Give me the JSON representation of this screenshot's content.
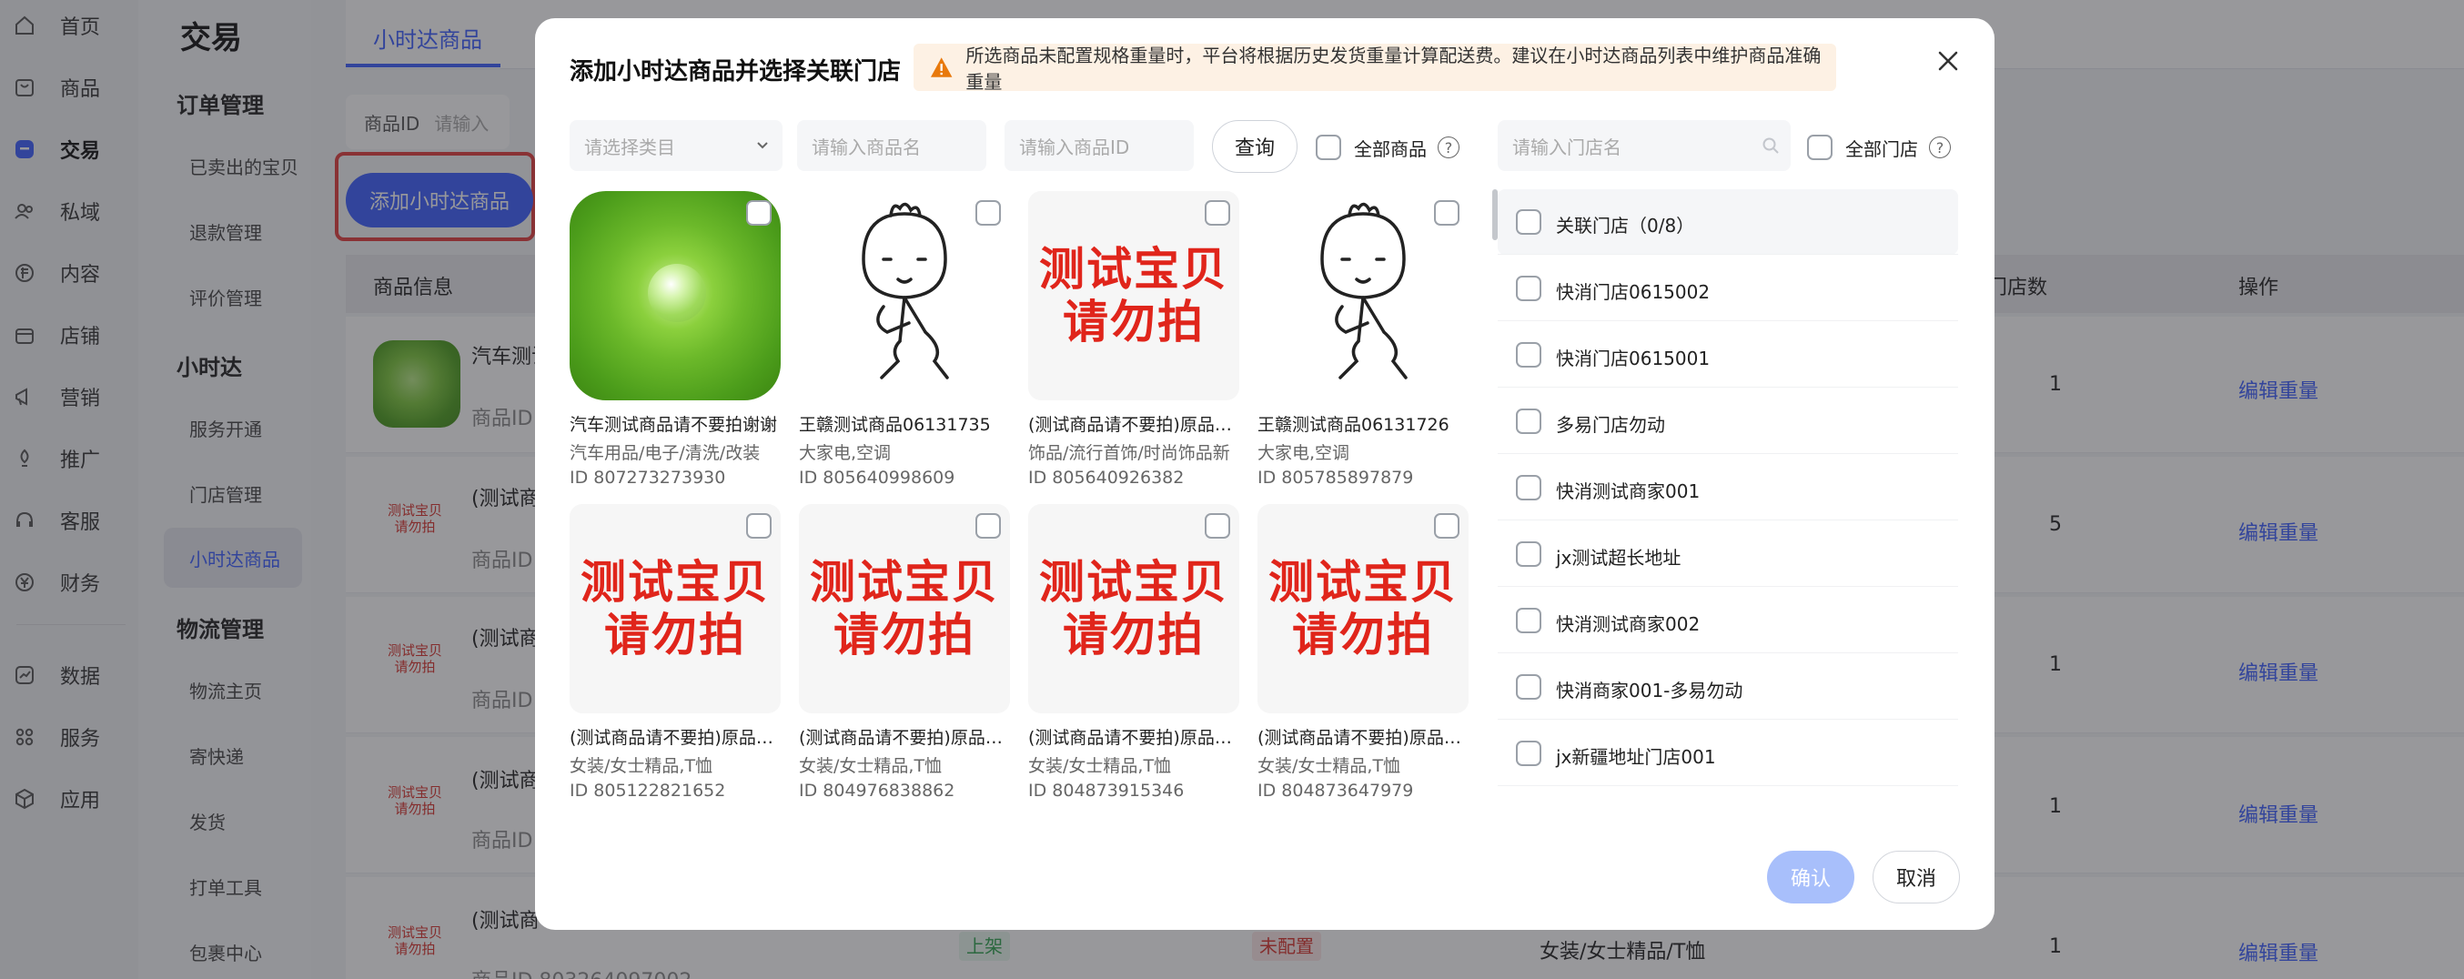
{
  "nav": {
    "items": [
      {
        "label": "首页",
        "icon": "home-icon"
      },
      {
        "label": "商品",
        "icon": "product-icon"
      },
      {
        "label": "交易",
        "icon": "trade-icon"
      },
      {
        "label": "私域",
        "icon": "private-domain-icon"
      },
      {
        "label": "内容",
        "icon": "content-icon"
      },
      {
        "label": "店铺",
        "icon": "shop-icon"
      },
      {
        "label": "营销",
        "icon": "marketing-icon"
      },
      {
        "label": "推广",
        "icon": "promotion-icon"
      },
      {
        "label": "客服",
        "icon": "customer-service-icon"
      },
      {
        "label": "财务",
        "icon": "finance-icon"
      },
      {
        "label": "数据",
        "icon": "data-icon"
      },
      {
        "label": "服务",
        "icon": "service-icon"
      },
      {
        "label": "应用",
        "icon": "app-icon"
      }
    ]
  },
  "sidebar": {
    "title": "交易",
    "groups": [
      {
        "label": "订单管理",
        "items": [
          "已卖出的宝贝",
          "退款管理",
          "评价管理"
        ]
      },
      {
        "label": "小时达",
        "items": [
          "服务开通",
          "门店管理",
          "小时达商品"
        ]
      },
      {
        "label": "物流管理",
        "items": [
          "物流主页",
          "寄快递",
          "发货",
          "打单工具",
          "包裹中心"
        ]
      }
    ]
  },
  "main": {
    "tab_active": "小时达商品",
    "filter_label": "商品ID",
    "filter_placeholder": "请输入",
    "add_button": "添加小时达商品",
    "table_headers": {
      "info": "商品信息",
      "store_count": "可售门店数",
      "action": "操作"
    },
    "rows": [
      {
        "name": "汽车测试",
        "sub": "商品ID",
        "store_count": "1",
        "action": "编辑重量"
      },
      {
        "name": "(测试商",
        "sub": "商品ID",
        "thumb": "测试宝贝请勿拍",
        "store_count": "5",
        "action": "编辑重量"
      },
      {
        "name": "(测试商",
        "sub": "商品ID",
        "thumb": "测试宝贝请勿拍",
        "store_count": "1",
        "action": "编辑重量"
      },
      {
        "name": "(测试商",
        "sub": "商品ID",
        "thumb": "测试宝贝请勿拍",
        "store_count": "1",
        "action": "编辑重量"
      },
      {
        "name": "(测试商",
        "sub": "商品ID 803264097002",
        "thumb": "测试宝贝请勿拍",
        "status": "上架",
        "weight": "未配置",
        "category": "女装/女士精品/T恤",
        "store_count": "1",
        "action": "编辑重量"
      }
    ]
  },
  "modal": {
    "title": "添加小时达商品并选择关联门店",
    "warning": "所选商品未配置规格重量时，平台将根据历史发货重量计算配送费。建议在小时达商品列表中维护商品准确重量",
    "category_placeholder": "请选择类目",
    "name_placeholder": "请输入商品名",
    "id_placeholder": "请输入商品ID",
    "query_button": "查询",
    "all_products_label": "全部商品",
    "store_search_placeholder": "请输入门店名",
    "all_stores_label": "全部门店",
    "products": [
      {
        "name": "汽车测试商品请不要拍谢谢",
        "category": "汽车用品/电子/清洗/改装",
        "id": "ID  807273273930",
        "image": "leaf"
      },
      {
        "name": "王赣测试商品06131735",
        "category": "大家电,空调",
        "id": "ID  805640998609",
        "image": "cartoon"
      },
      {
        "name": "(测试商品请不要拍)原品上架",
        "category": "饰品/流行首饰/时尚饰品新",
        "id": "ID  805640926382",
        "image": "text"
      },
      {
        "name": "王赣测试商品06131726",
        "category": "大家电,空调",
        "id": "ID  805785897879",
        "image": "cartoon"
      },
      {
        "name": "(测试商品请不要拍)原品上架",
        "category": "女装/女士精品,T恤",
        "id": "ID  805122821652",
        "image": "text"
      },
      {
        "name": "(测试商品请不要拍)原品上架",
        "category": "女装/女士精品,T恤",
        "id": "ID  804976838862",
        "image": "text"
      },
      {
        "name": "(测试商品请不要拍)原品上架",
        "category": "女装/女士精品,T恤",
        "id": "ID  804873915346",
        "image": "text"
      },
      {
        "name": "(测试商品请不要拍)原品上架",
        "category": "女装/女士精品,T恤",
        "id": "ID  804873647979",
        "image": "text"
      }
    ],
    "placeholder_image_text": [
      "测试宝贝",
      "请勿拍"
    ],
    "stores": [
      "关联门店（0/8）",
      "快消门店0615002",
      "快消门店0615001",
      "多易门店勿动",
      "快消测试商家001",
      "jx测试超长地址",
      "快消测试商家002",
      "快消商家001-多易勿动",
      "jx新疆地址门店001"
    ],
    "confirm": "确认",
    "cancel": "取消"
  },
  "colors": {
    "accent": "#3d5fff",
    "danger": "#e23d3d",
    "warning_bg": "#fdf1e4"
  }
}
